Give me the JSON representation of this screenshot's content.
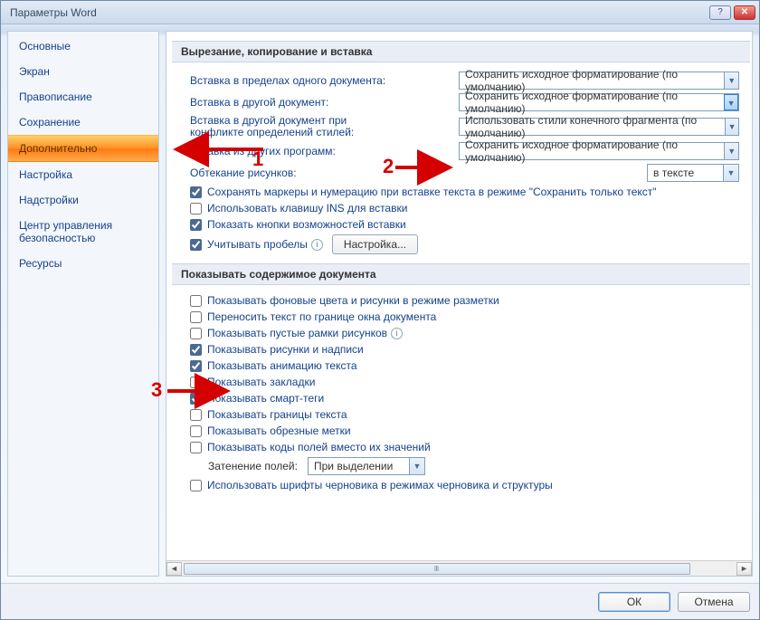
{
  "window": {
    "title": "Параметры Word"
  },
  "sidebar": {
    "items": [
      "Основные",
      "Экран",
      "Правописание",
      "Сохранение",
      "Дополнительно",
      "Настройка",
      "Надстройки",
      "Центр управления безопасностью",
      "Ресурсы"
    ],
    "selectedIndex": 4
  },
  "sections": {
    "cut_copy_paste": {
      "title": "Вырезание, копирование и вставка",
      "paste_within_doc": {
        "label": "Вставка в пределах одного документа:",
        "value": "Сохранить исходное форматирование (по умолчанию)"
      },
      "paste_other_doc": {
        "label": "Вставка в другой документ:",
        "value": "Сохранить исходное форматирование (по умолчанию)"
      },
      "paste_style_conf": {
        "label": "Вставка в другой документ при конфликте определений стилей:",
        "value": "Использовать стили конечного фрагмента (по умолчанию)"
      },
      "paste_other_prog": {
        "label": "Вставка из других программ:",
        "value": "Сохранить исходное форматирование (по умолчанию)"
      },
      "picture_wrap": {
        "label": "Обтекание рисунков:",
        "value": "в тексте"
      },
      "keep_bullets": {
        "label": "Сохранять маркеры и нумерацию при вставке текста в режиме \"Сохранить только текст\"",
        "checked": true
      },
      "ins_key": {
        "label": "Использовать клавишу INS для вставки",
        "checked": false
      },
      "paste_options": {
        "label": "Показать кнопки возможностей вставки",
        "checked": true
      },
      "smart_paste": {
        "label": "Учитывать пробелы",
        "checked": true,
        "btn": "Настройка..."
      }
    },
    "show_content": {
      "title": "Показывать содержимое документа",
      "bg_colors": {
        "label": "Показывать фоновые цвета и рисунки в режиме разметки",
        "checked": false
      },
      "wrap_window": {
        "label": "Переносить текст по границе окна документа",
        "checked": false
      },
      "placeholders": {
        "label": "Показывать пустые рамки рисунков",
        "checked": false
      },
      "drawings": {
        "label": "Показывать рисунки и надписи",
        "checked": true
      },
      "animation": {
        "label": "Показывать анимацию текста",
        "checked": true
      },
      "bookmarks": {
        "label": "Показывать закладки",
        "checked": false
      },
      "smart_tags": {
        "label": "Показывать смарт-теги",
        "checked": true
      },
      "boundaries": {
        "label": "Показывать границы текста",
        "checked": false
      },
      "crop_marks": {
        "label": "Показывать обрезные метки",
        "checked": false
      },
      "field_codes": {
        "label": "Показывать коды полей вместо их значений",
        "checked": false
      },
      "field_shade": {
        "label": "Затенение полей:",
        "value": "При выделении"
      },
      "draft_fonts": {
        "label": "Использовать шрифты черновика в режимах черновика и структуры",
        "checked": false
      }
    }
  },
  "footer": {
    "ok": "ОК",
    "cancel": "Отмена"
  },
  "annotations": {
    "n1": "1",
    "n2": "2",
    "n3": "3"
  }
}
